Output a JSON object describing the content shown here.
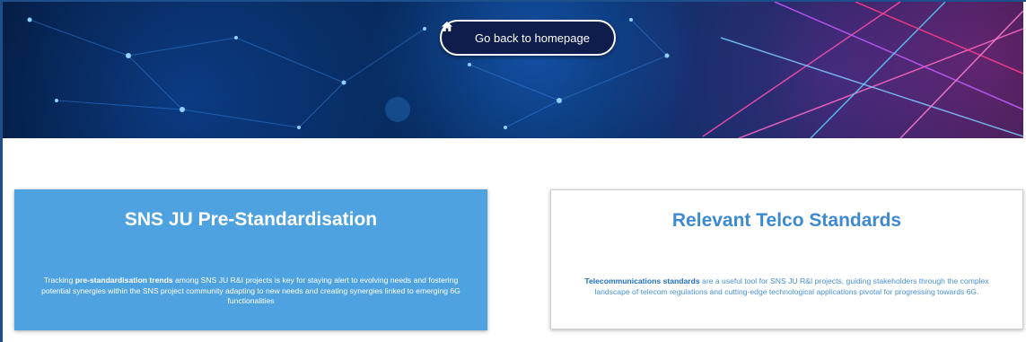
{
  "header": {
    "home_button_label": "Go back to homepage",
    "home_icon": "home-icon"
  },
  "cards": [
    {
      "title": "SNS JU Pre-Standardisation",
      "desc_prefix": "Tracking ",
      "desc_bold": "pre-standardisation trends",
      "desc_rest": " among SNS JU R&I projects is key for staying alert to evolving needs and fostering potential synergies within the SNS project community adapting to new needs and creating synergies linked to emerging 6G functionalities",
      "background": "#4ea2e0"
    },
    {
      "title": "Relevant Telco Standards",
      "desc_bold": "Telecommunications standards",
      "desc_rest": " are a useful tool for SNS JU R&I projects, guiding stakeholders through the complex landscape of telecom regulations and cutting-edge technological applications pivotal for progressing towards 6G.",
      "background": "#ffffff"
    }
  ]
}
